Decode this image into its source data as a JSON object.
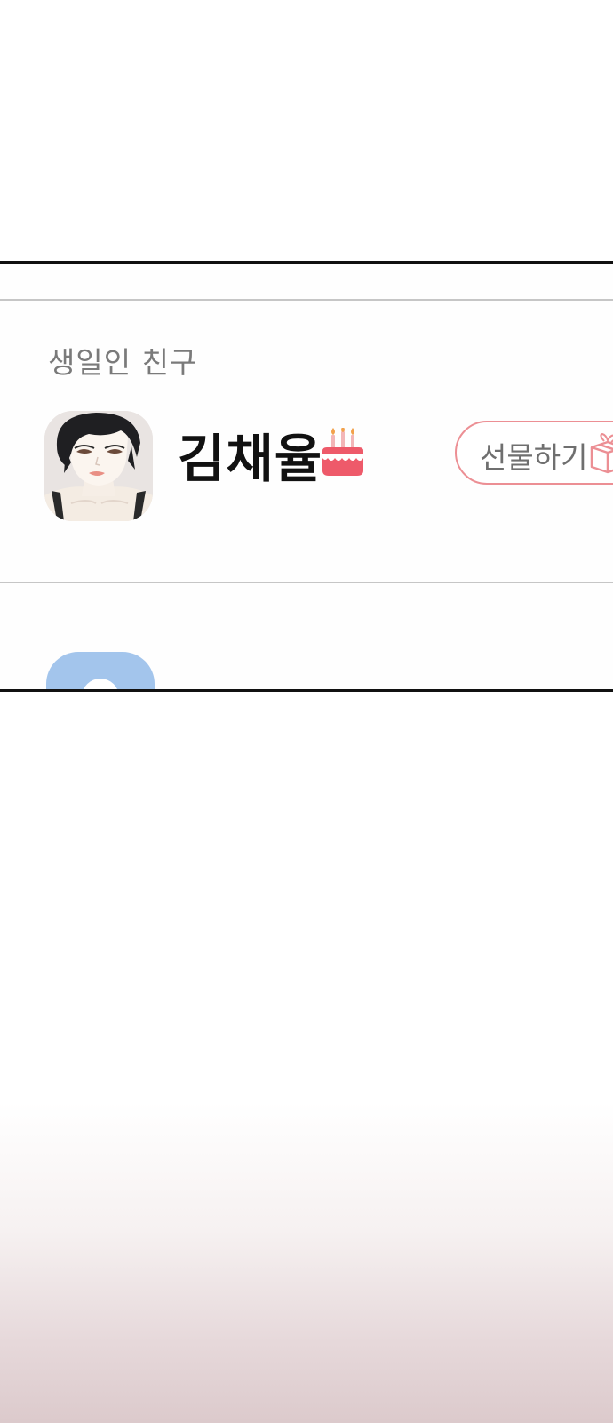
{
  "section": {
    "title": "생일인 친구"
  },
  "friend": {
    "name": "김채율",
    "gift_button_label": "선물하기"
  },
  "icons": {
    "avatar": "profile-avatar-illustration",
    "cake": "birthday-cake-icon",
    "gift": "gift-box-icon",
    "next_avatar": "default-person-avatar"
  },
  "colors": {
    "gift_button_border": "#ec8f94",
    "cake": "#ee5a6a",
    "next_avatar_bg": "#a3c5ec",
    "section_title": "#7a7a7a",
    "friend_name": "#111111"
  }
}
